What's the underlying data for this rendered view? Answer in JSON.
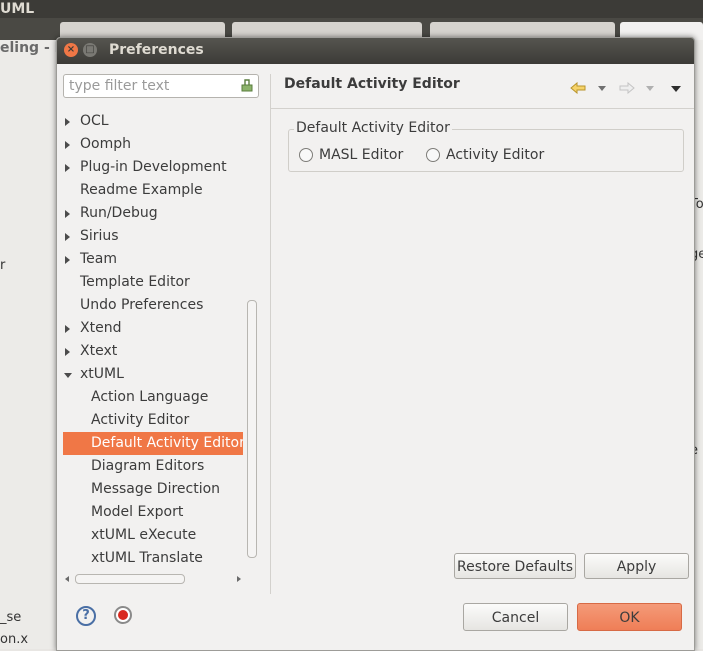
{
  "background": {
    "app_title": "UML",
    "left_panel_title": "eling - B",
    "left_fragments": [
      "r",
      "_se",
      "on.x"
    ],
    "right_fragments": [
      "To",
      "ge",
      "e"
    ]
  },
  "dialog": {
    "title": "Preferences",
    "filter_placeholder": "type filter text",
    "tree": [
      {
        "label": "OCL",
        "arrow": "collapsed",
        "indent": 0
      },
      {
        "label": "Oomph",
        "arrow": "collapsed",
        "indent": 0
      },
      {
        "label": "Plug-in Development",
        "arrow": "collapsed",
        "indent": 0
      },
      {
        "label": "Readme Example",
        "arrow": "none",
        "indent": 0
      },
      {
        "label": "Run/Debug",
        "arrow": "collapsed",
        "indent": 0
      },
      {
        "label": "Sirius",
        "arrow": "collapsed",
        "indent": 0
      },
      {
        "label": "Team",
        "arrow": "collapsed",
        "indent": 0
      },
      {
        "label": "Template Editor",
        "arrow": "none",
        "indent": 0
      },
      {
        "label": "Undo Preferences",
        "arrow": "none",
        "indent": 0
      },
      {
        "label": "Xtend",
        "arrow": "collapsed",
        "indent": 0
      },
      {
        "label": "Xtext",
        "arrow": "collapsed",
        "indent": 0
      },
      {
        "label": "xtUML",
        "arrow": "expanded",
        "indent": 0
      },
      {
        "label": "Action Language",
        "arrow": "none",
        "indent": 1
      },
      {
        "label": "Activity Editor",
        "arrow": "none",
        "indent": 1
      },
      {
        "label": "Default Activity Editor",
        "arrow": "none",
        "indent": 1,
        "selected": true
      },
      {
        "label": "Diagram Editors",
        "arrow": "none",
        "indent": 1
      },
      {
        "label": "Message Direction",
        "arrow": "none",
        "indent": 1
      },
      {
        "label": "Model Export",
        "arrow": "none",
        "indent": 1
      },
      {
        "label": "xtUML eXecute",
        "arrow": "none",
        "indent": 1
      },
      {
        "label": "xtUML Translate",
        "arrow": "none",
        "indent": 1
      }
    ],
    "page": {
      "title": "Default Activity Editor",
      "group_label": "Default Activity Editor",
      "options": [
        {
          "label": "MASL Editor",
          "checked": false
        },
        {
          "label": "Activity Editor",
          "checked": false
        }
      ]
    },
    "buttons": {
      "restore_defaults": "Restore Defaults",
      "apply": "Apply",
      "cancel": "Cancel",
      "ok": "OK"
    },
    "colors": {
      "accent": "#f07746",
      "titlebar": "#3c3b37"
    }
  }
}
